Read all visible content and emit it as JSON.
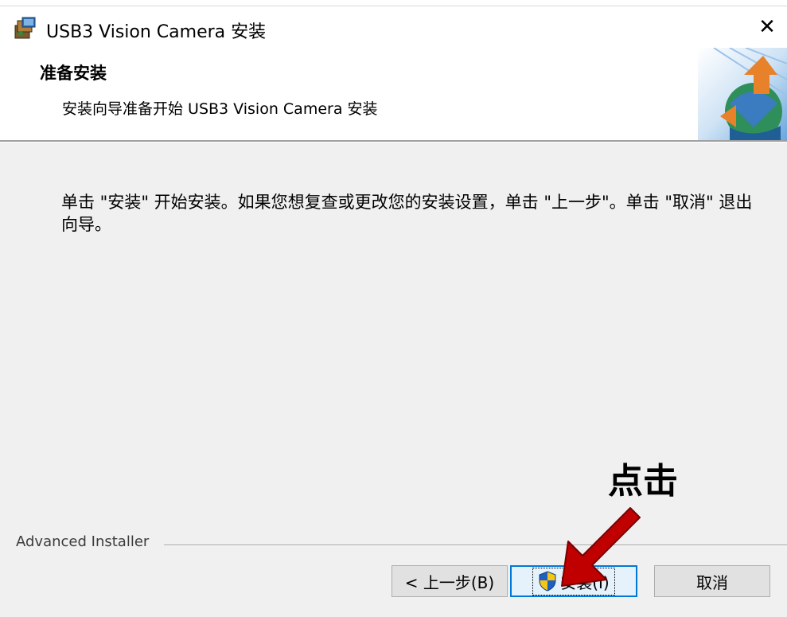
{
  "window": {
    "title": "USB3 Vision Camera 安装",
    "close_glyph": "✕",
    "app_icon": "installer-package-icon"
  },
  "header": {
    "title": "准备安装",
    "subtitle": "安装向导准备开始 USB3 Vision Camera 安装",
    "logo_icon": "advanced-installer-logo-icon"
  },
  "body": {
    "text": "单击 \"安装\" 开始安装。如果您想复查或更改您的安装设置，单击 \"上一步\"。单击 \"取消\" 退出向导。"
  },
  "annotation": {
    "label": "点击",
    "arrow_color": "#c00000"
  },
  "footer": {
    "brand": "Advanced Installer"
  },
  "buttons": {
    "back": "< 上一步(B)",
    "install": "安装(I)",
    "cancel": "取消",
    "install_icon": "uac-shield-icon"
  },
  "colors": {
    "dialog_bg": "#f0f0f0",
    "header_bg": "#ffffff",
    "focus_border": "#0078d7",
    "annotation_arrow": "#c00000"
  }
}
